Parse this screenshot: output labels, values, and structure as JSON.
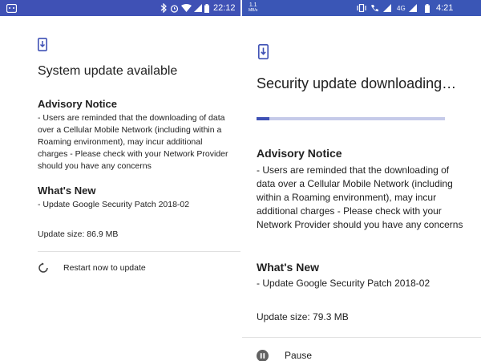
{
  "left_screen": {
    "status_bar": {
      "time": "22:12",
      "icons": [
        "android-debug-icon",
        "bluetooth-icon",
        "alarm-icon",
        "wifi-icon",
        "signal-icon",
        "battery-icon"
      ]
    },
    "title": "System update available",
    "advisory": {
      "heading": "Advisory Notice",
      "text": "- Users are reminded that the downloading of data over a Cellular Mobile Network (including within a Roaming environment), may incur additional charges - Please check with your Network Provider should you have any concerns"
    },
    "whats_new": {
      "heading": "What's New",
      "text": "- Update Google Security Patch 2018-02"
    },
    "update_size": "Update size: 86.9 MB",
    "action_label": "Restart now to update"
  },
  "right_screen": {
    "status_bar": {
      "time": "4:21",
      "data_rate_value": "1.1",
      "data_rate_unit": "MB/s",
      "network_label": "4G",
      "icons": [
        "vibrate-icon",
        "call-icon",
        "signal-icon",
        "battery-icon"
      ]
    },
    "title": "Security update downloading…",
    "progress_fraction": 0.07,
    "advisory": {
      "heading": "Advisory Notice",
      "text": "- Users are reminded that the downloading of data over a Cellular Mobile Network (including within a Roaming environment), may incur additional charges - Please check with your Network Provider should you have any concerns"
    },
    "whats_new": {
      "heading": "What's New",
      "text": "- Update Google Security Patch 2018-02"
    },
    "update_size": "Update size: 79.3 MB",
    "action_label": "Pause"
  },
  "colors": {
    "status_bar": "#3f51b5",
    "accent": "#3f51b5",
    "progress_track": "#c5cae9",
    "text": "#212121",
    "divider": "#e0e0e0"
  }
}
